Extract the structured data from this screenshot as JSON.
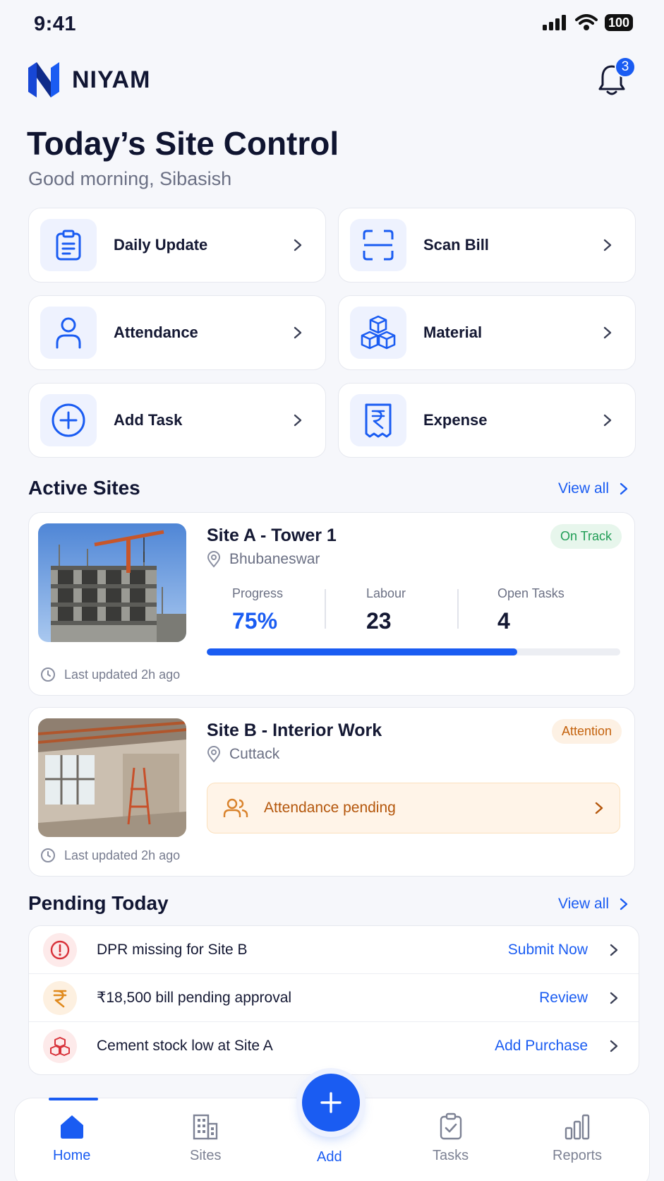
{
  "status_bar": {
    "time": "9:41",
    "battery": "100"
  },
  "header": {
    "brand": "NIYAM",
    "notification_count": "3"
  },
  "title": "Today’s Site Control",
  "greeting": "Good morning, Sibasish",
  "quick_actions": [
    {
      "label": "Daily Update",
      "icon": "clipboard-icon"
    },
    {
      "label": "Scan Bill",
      "icon": "scan-icon"
    },
    {
      "label": "Attendance",
      "icon": "person-icon"
    },
    {
      "label": "Material",
      "icon": "boxes-icon"
    },
    {
      "label": "Add Task",
      "icon": "plus-circle-icon"
    },
    {
      "label": "Expense",
      "icon": "receipt-rupee-icon"
    }
  ],
  "active_sites": {
    "title": "Active Sites",
    "view_all": "View all",
    "sites": [
      {
        "name": "Site A - Tower 1",
        "location": "Bhubaneswar",
        "status": "On Track",
        "stats": [
          {
            "label": "Progress",
            "value": "75%"
          },
          {
            "label": "Labour",
            "value": "23"
          },
          {
            "label": "Open Tasks",
            "value": "4"
          }
        ],
        "progress": 0.75,
        "last_updated": "Last updated 2h ago"
      },
      {
        "name": "Site B - Interior Work",
        "location": "Cuttack",
        "status": "Attention",
        "alert": "Attendance pending",
        "last_updated": "Last updated 2h ago"
      }
    ]
  },
  "pending_today": {
    "title": "Pending Today",
    "view_all": "View all",
    "items": [
      {
        "text": "DPR missing for Site B",
        "action": "Submit Now",
        "icon": "alert-icon"
      },
      {
        "text": "₹18,500 bill pending approval",
        "action": "Review",
        "icon": "rupee-icon"
      },
      {
        "text": "Cement stock low at Site A",
        "action": "Add Purchase",
        "icon": "stock-icon"
      }
    ]
  },
  "bottom_nav": [
    {
      "label": "Home",
      "active": true
    },
    {
      "label": "Sites"
    },
    {
      "label": "Add"
    },
    {
      "label": "Tasks"
    },
    {
      "label": "Reports"
    }
  ],
  "colors": {
    "accent": "#1a5cf2",
    "on_track": "#1f9d55",
    "attention": "#c4620d"
  }
}
